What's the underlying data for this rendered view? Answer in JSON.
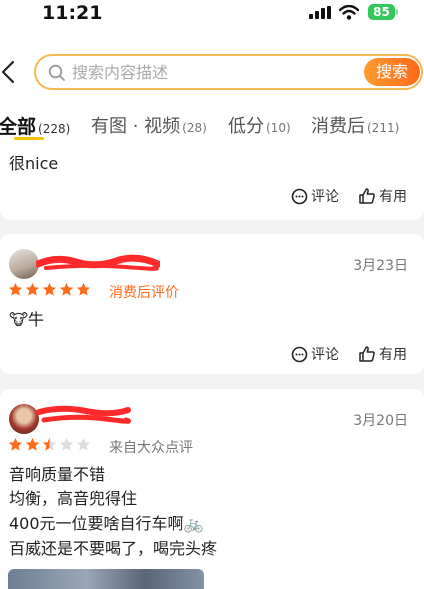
{
  "status_bar": {
    "time": "11:21",
    "battery": "85"
  },
  "search": {
    "placeholder": "搜索内容描述",
    "button_label": "搜索"
  },
  "tabs": [
    {
      "label": "全部",
      "count": "(228)",
      "active": true
    },
    {
      "label": "有图 · 视频",
      "count": "(28)",
      "active": false
    },
    {
      "label": "低分",
      "count": "(10)",
      "active": false
    },
    {
      "label": "消费后",
      "count": "(211)",
      "active": false
    }
  ],
  "actions": {
    "comment": "评论",
    "like": "有用"
  },
  "reviews": [
    {
      "text": "很nice"
    },
    {
      "date": "3月23日",
      "rating": 5,
      "tag": "消费后评价",
      "tag_color": "#ff6a1a",
      "text_emoji": "🐮",
      "text": "牛"
    },
    {
      "date": "3月20日",
      "rating": 2.5,
      "tag": "来自大众点评",
      "tag_color": "#777777",
      "lines": [
        "音响质量不错",
        "均衡，高音兜得住",
        "400元一位要啥自行车啊🚲",
        "百威还是不要喝了，喝完头疼"
      ]
    }
  ],
  "colors": {
    "accent": "#ff6a1a",
    "star": "#ff6a1a",
    "tab_underline": "#f5c000",
    "search_border": "#f5b94f",
    "redaction": "#ff2a2a"
  },
  "icons": [
    "back-icon",
    "search-icon",
    "comment-icon",
    "thumbs-up-icon",
    "star-icon",
    "signal-icon",
    "wifi-icon",
    "battery-icon"
  ]
}
